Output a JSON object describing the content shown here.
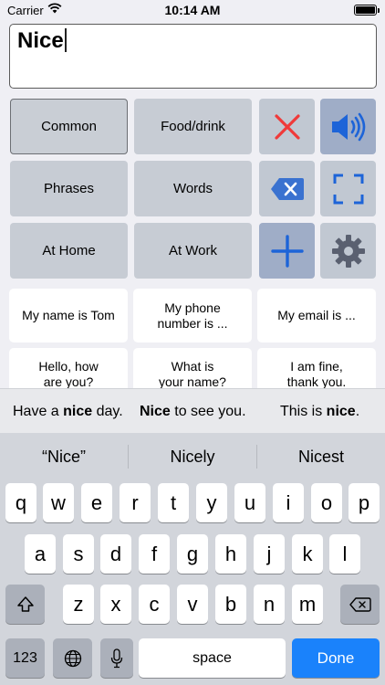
{
  "status": {
    "carrier": "Carrier",
    "time": "10:14 AM"
  },
  "textbox": {
    "value": "Nice"
  },
  "categories": [
    {
      "label": "Common",
      "selected": true
    },
    {
      "label": "Food/drink"
    },
    {
      "label": "Phrases"
    },
    {
      "label": "Words"
    },
    {
      "label": "At Home"
    },
    {
      "label": "At Work"
    }
  ],
  "actions": {
    "clear": "close-icon",
    "speak": "speaker-icon",
    "backspace": "delete-left-icon",
    "fullscreen": "fullscreen-icon",
    "add": "plus-icon",
    "settings": "gear-icon",
    "colors": {
      "red": "#f03a3a",
      "blue": "#1d64d8",
      "gray": "#5a6070"
    }
  },
  "phrases": [
    {
      "line1": "My name is Tom",
      "line2": ""
    },
    {
      "line1": "My phone",
      "line2": "number is ..."
    },
    {
      "line1": "My email is ...",
      "line2": ""
    },
    {
      "line1": "Hello, how",
      "line2": "are you?"
    },
    {
      "line1": "What is",
      "line2": "your name?"
    },
    {
      "line1": "I am fine,",
      "line2": "thank you."
    }
  ],
  "suggestions": [
    {
      "pre": "Have a ",
      "bold": "nice",
      "post": " day."
    },
    {
      "pre": "",
      "bold": "Nice",
      "post": " to see you."
    },
    {
      "pre": "This is ",
      "bold": "nice",
      "post": "."
    }
  ],
  "keyboard": {
    "predictions": [
      "“Nice”",
      "Nicely",
      "Nicest"
    ],
    "row1": [
      "q",
      "w",
      "e",
      "r",
      "t",
      "y",
      "u",
      "i",
      "o",
      "p"
    ],
    "row2": [
      "a",
      "s",
      "d",
      "f",
      "g",
      "h",
      "j",
      "k",
      "l"
    ],
    "row3": [
      "z",
      "x",
      "c",
      "v",
      "b",
      "n",
      "m"
    ],
    "numbers_label": "123",
    "space_label": "space",
    "done_label": "Done"
  }
}
